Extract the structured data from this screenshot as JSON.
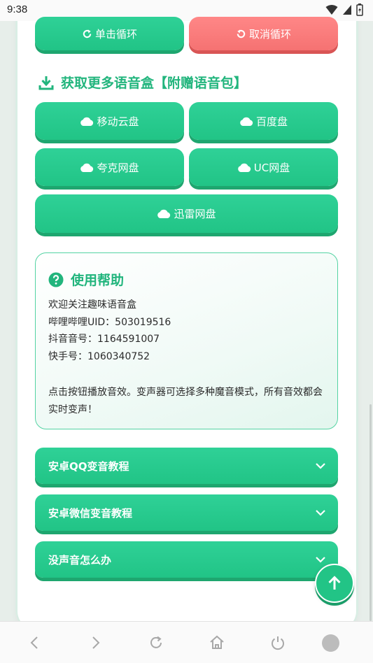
{
  "status_bar": {
    "time": "9:38"
  },
  "loop_buttons": {
    "single_loop": "单击循环",
    "cancel_loop": "取消循环"
  },
  "download_section": {
    "title": "获取更多语音盒【附赠语音包】",
    "buttons": [
      "移动云盘",
      "百度盘",
      "夸克网盘",
      "UC网盘",
      "迅雷网盘"
    ]
  },
  "help": {
    "title": "使用帮助",
    "lines": [
      "欢迎关注趣味语音盒",
      "哔哩哔哩UID：503019516",
      "抖音音号：1164591007",
      "快手号：1060340752"
    ],
    "paragraph": "点击按钮播放音效。变声器可选择多种魔音模式，所有音效都会实时变声！"
  },
  "accordions": [
    "安卓QQ变音教程",
    "安卓微信变音教程",
    "没声音怎么办"
  ],
  "colors": {
    "accent": "#22c486",
    "danger": "#f57272"
  },
  "icons": {
    "loop": "refresh-icon",
    "cancel": "undo-icon",
    "download": "download-icon",
    "cloud": "cloud-icon",
    "help": "question-circle-icon",
    "top": "arrow-up-icon"
  }
}
